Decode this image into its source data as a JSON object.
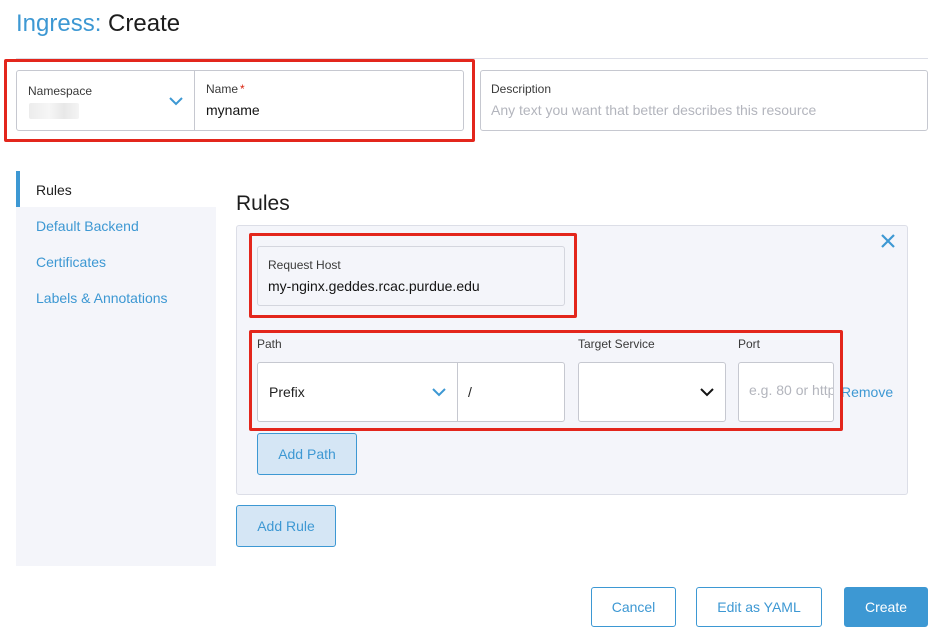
{
  "header": {
    "resource": "Ingress:",
    "action": "Create"
  },
  "meta": {
    "namespace_label": "Namespace",
    "name_label": "Name",
    "name_required": "*",
    "name_value": "myname",
    "description_label": "Description",
    "description_placeholder": "Any text you want that better describes this resource"
  },
  "tabs": [
    {
      "label": "Rules",
      "active": true
    },
    {
      "label": "Default Backend",
      "active": false
    },
    {
      "label": "Certificates",
      "active": false
    },
    {
      "label": "Labels & Annotations",
      "active": false
    }
  ],
  "rules": {
    "title": "Rules",
    "request_host_label": "Request Host",
    "request_host_value": "my-nginx.geddes.rcac.purdue.edu",
    "path_label": "Path",
    "path_type": "Prefix",
    "path_value": "/",
    "target_service_label": "Target Service",
    "target_service_value": "",
    "port_label": "Port",
    "port_placeholder": "e.g. 80 or http",
    "remove_label": "Remove",
    "add_path_label": "Add Path",
    "add_rule_label": "Add Rule"
  },
  "footer": {
    "cancel": "Cancel",
    "edit_yaml": "Edit as YAML",
    "create": "Create"
  },
  "colors": {
    "accent": "#3d98d3",
    "highlight": "#e3261c"
  },
  "icons": {
    "chevron": "chevron-down-icon",
    "close": "close-icon"
  }
}
